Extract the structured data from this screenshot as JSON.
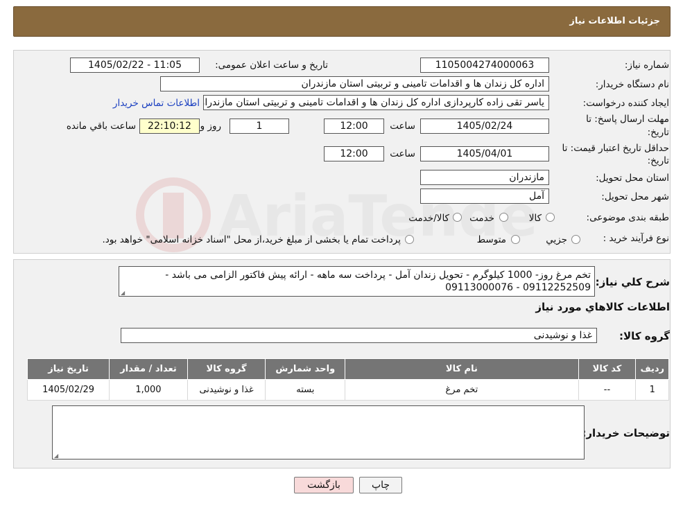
{
  "header": {
    "title": "جزئیات اطلاعات نیاز"
  },
  "fields": {
    "need_number_label": "شماره نیاز:",
    "need_number": "1105004274000063",
    "announce_label": "تاریخ و ساعت اعلان عمومی:",
    "announce_value": "1405/02/22 - 11:05",
    "buyer_org_label": "نام دستگاه خریدار:",
    "buyer_org": "اداره کل زندان ها و اقدامات تامینی و تربیتی استان مازندران",
    "creator_label": "ایجاد کننده درخواست:",
    "creator": "یاسر تقی زاده کارپردازی اداره کل زندان ها و اقدامات تامینی و تربیتی استان مازندران",
    "contact_link": "اطلاعات تماس خریدار",
    "deadline_label_1": "مهلت ارسال پاسخ: تا",
    "deadline_label_2": "تاریخ:",
    "deadline_date": "1405/02/24",
    "hour_label": "ساعت",
    "deadline_time": "12:00",
    "days_value": "1",
    "days_label": "روز و",
    "remaining_time": "22:10:12",
    "remaining_label": "ساعت باقي مانده",
    "validity_label_1": "حداقل تاریخ اعتبار قیمت: تا",
    "validity_label_2": "تاریخ:",
    "validity_date": "1405/04/01",
    "validity_time": "12:00",
    "province_label": "استان محل تحویل:",
    "province": "مازندران",
    "city_label": "شهر محل تحویل:",
    "city": "آمل",
    "category_label": "طبقه بندی موضوعی:",
    "category_options": [
      "کالا",
      "خدمت",
      "کالا/خدمت"
    ],
    "process_label": "نوع فرآیند خرید :",
    "process_options": [
      "جزيي",
      "متوسط"
    ],
    "process_note": "پرداخت تمام یا بخشی از مبلغ خرید،از محل \"اسناد خزانه اسلامی\" خواهد بود."
  },
  "description": {
    "label": "شرح کلي نياز:",
    "text": "تخم مرغ روز- 1000 کیلوگرم -  تحویل زندان آمل - پرداخت سه ماهه - ارائه پیش فاکتور الزامی می باشد - 09112252509 - 09113000076"
  },
  "goods": {
    "section_title": "اطلاعات کالاهاي مورد نياز",
    "group_label": "گروه کالا:",
    "group_value": "غذا و نوشیدنی",
    "columns": [
      "رديف",
      "کد کالا",
      "نام کالا",
      "واحد شمارش",
      "گروه کالا",
      "تعداد / مقدار",
      "تاریخ نیاز"
    ],
    "rows": [
      [
        "1",
        "--",
        "تخم مرغ",
        "بسته",
        "غذا و نوشیدنی",
        "1,000",
        "1405/02/29"
      ]
    ]
  },
  "buyer_notes": {
    "label": "توضیحات خریدار:",
    "value": ""
  },
  "buttons": {
    "print": "چاپ",
    "back": "بازگشت"
  },
  "colors": {
    "header_bg": "#8a6a3e",
    "table_header_bg": "#757575",
    "link": "#1a3fc0",
    "back_button_bg": "#f8dada"
  }
}
